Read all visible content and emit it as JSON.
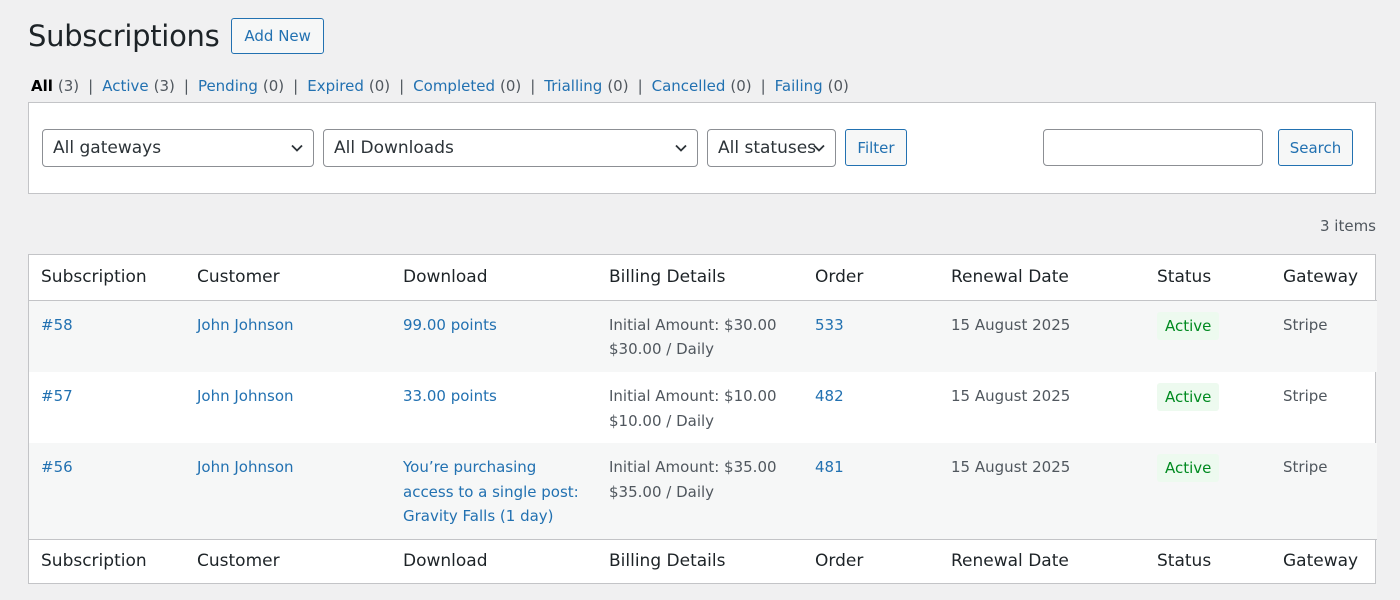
{
  "header": {
    "title": "Subscriptions",
    "add_new_label": "Add New"
  },
  "views": [
    {
      "label": "All",
      "count": "(3)",
      "current": true
    },
    {
      "label": "Active",
      "count": "(3)"
    },
    {
      "label": "Pending",
      "count": "(0)"
    },
    {
      "label": "Expired",
      "count": "(0)"
    },
    {
      "label": "Completed",
      "count": "(0)"
    },
    {
      "label": "Trialling",
      "count": "(0)"
    },
    {
      "label": "Cancelled",
      "count": "(0)"
    },
    {
      "label": "Failing",
      "count": "(0)"
    }
  ],
  "view_separator": "|",
  "filters": {
    "gateway_selected": "All gateways",
    "download_selected": "All Downloads",
    "status_selected": "All statuses",
    "filter_label": "Filter",
    "search_value": "",
    "search_label": "Search"
  },
  "items_count": "3 items",
  "table": {
    "columns": [
      "Subscription",
      "Customer",
      "Download",
      "Billing Details",
      "Order",
      "Renewal Date",
      "Status",
      "Gateway"
    ],
    "rows": [
      {
        "subscription": "#58",
        "customer": "John Johnson",
        "download": "99.00 points",
        "billing_initial": "Initial Amount: $30.00",
        "billing_recurring": "$30.00 / Daily",
        "order": "533",
        "renewal_date": "15 August 2025",
        "status": "Active",
        "gateway": "Stripe"
      },
      {
        "subscription": "#57",
        "customer": "John Johnson",
        "download": "33.00 points",
        "billing_initial": "Initial Amount: $10.00",
        "billing_recurring": "$10.00 / Daily",
        "order": "482",
        "renewal_date": "15 August 2025",
        "status": "Active",
        "gateway": "Stripe"
      },
      {
        "subscription": "#56",
        "customer": "John Johnson",
        "download": "You’re purchasing access to a single post: Gravity Falls (1 day)",
        "billing_initial": "Initial Amount: $35.00",
        "billing_recurring": "$35.00 / Daily",
        "order": "481",
        "renewal_date": "15 August 2025",
        "status": "Active",
        "gateway": "Stripe"
      }
    ]
  },
  "colors": {
    "link": "#2271b1",
    "background": "#f0f0f1",
    "status_active_bg": "#edfaef",
    "status_active_text": "#008a20"
  },
  "icons": {
    "dropdown": "chevron-down-icon"
  }
}
